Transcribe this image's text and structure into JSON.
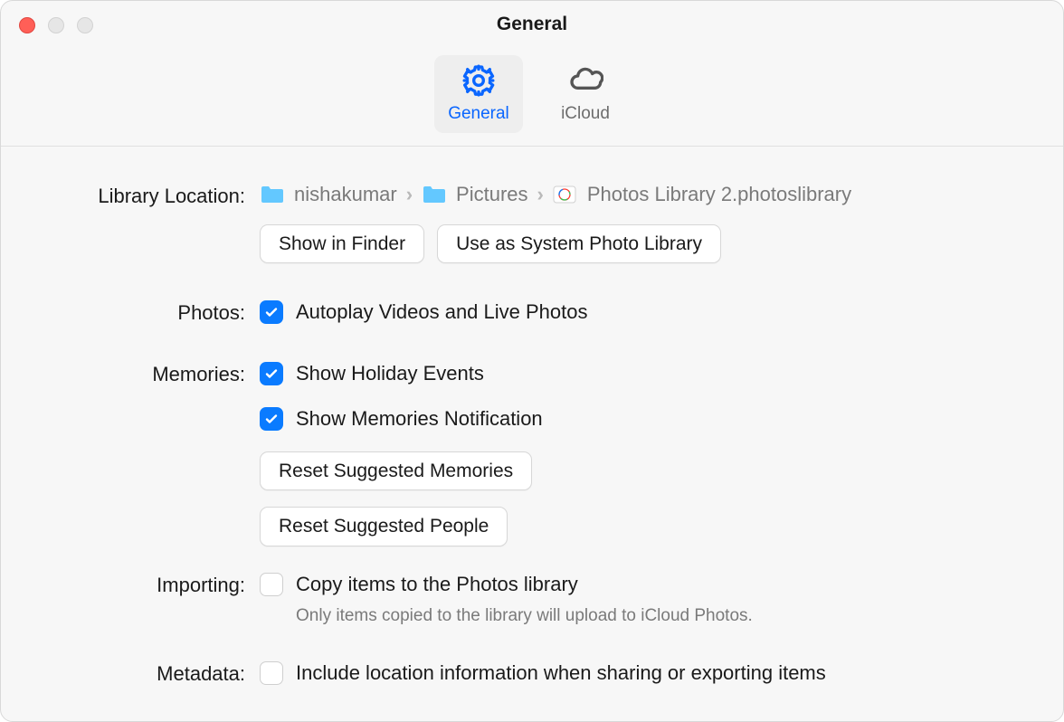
{
  "window": {
    "title": "General"
  },
  "tabs": {
    "general": "General",
    "icloud": "iCloud"
  },
  "labels": {
    "library_location": "Library Location:",
    "photos": "Photos:",
    "memories": "Memories:",
    "importing": "Importing:",
    "metadata": "Metadata:"
  },
  "breadcrumb": {
    "seg1": "nishakumar",
    "seg2": "Pictures",
    "seg3": "Photos Library 2.photoslibrary"
  },
  "buttons": {
    "show_in_finder": "Show in Finder",
    "use_system": "Use as System Photo Library",
    "reset_memories": "Reset Suggested Memories",
    "reset_people": "Reset Suggested People"
  },
  "checks": {
    "autoplay": "Autoplay Videos and Live Photos",
    "holiday": "Show Holiday Events",
    "memories_notif": "Show Memories Notification",
    "copy_items": "Copy items to the Photos library",
    "metadata_loc": "Include location information when sharing or exporting items"
  },
  "hints": {
    "copy_items": "Only items copied to the library will upload to iCloud Photos."
  }
}
